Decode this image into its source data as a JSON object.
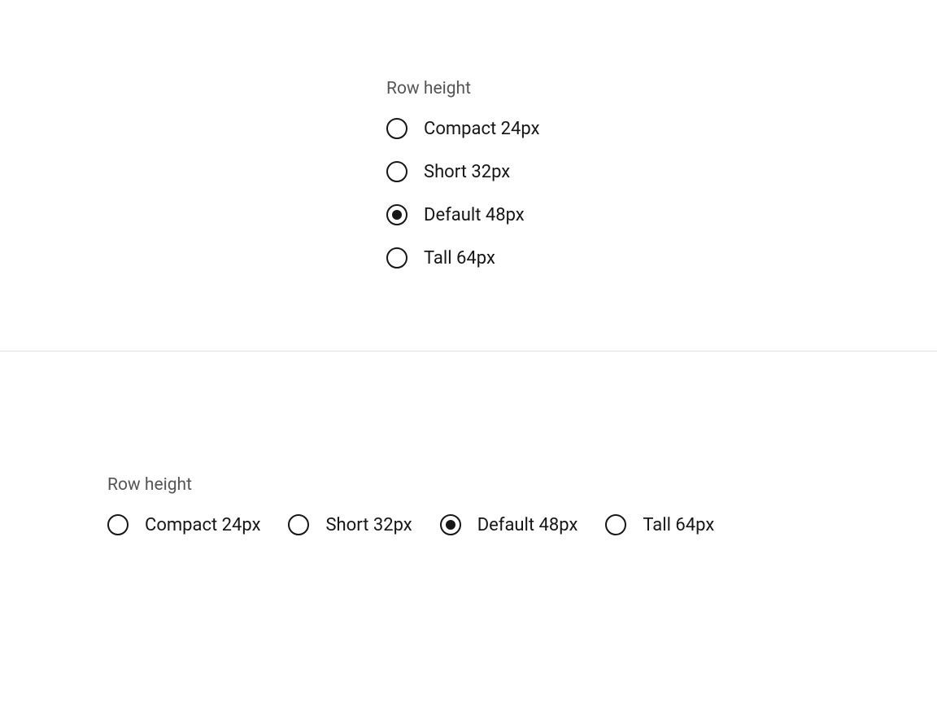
{
  "vertical": {
    "label": "Row height",
    "options": [
      {
        "label": "Compact 24px",
        "selected": false
      },
      {
        "label": "Short 32px",
        "selected": false
      },
      {
        "label": "Default 48px",
        "selected": true
      },
      {
        "label": "Tall 64px",
        "selected": false
      }
    ]
  },
  "horizontal": {
    "label": "Row height",
    "options": [
      {
        "label": "Compact 24px",
        "selected": false
      },
      {
        "label": "Short 32px",
        "selected": false
      },
      {
        "label": "Default 48px",
        "selected": true
      },
      {
        "label": "Tall 64px",
        "selected": false
      }
    ]
  }
}
